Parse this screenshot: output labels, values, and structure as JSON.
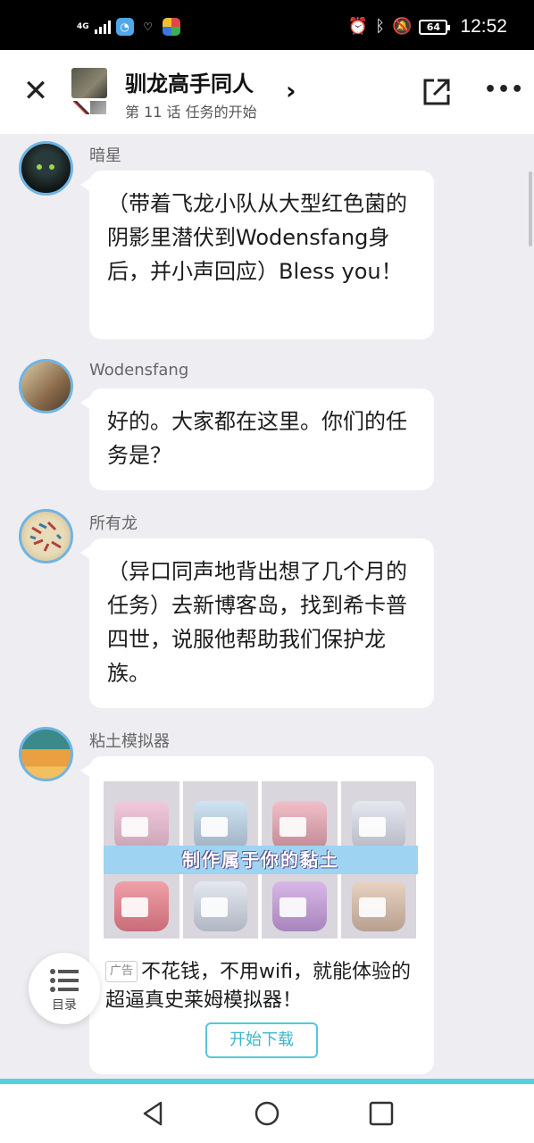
{
  "status_bar": {
    "network": "4G",
    "battery": "64",
    "time": "12:52"
  },
  "header": {
    "title": "驯龙高手同人",
    "subtitle": "第 11 话 任务的开始"
  },
  "messages": [
    {
      "name": "暗星",
      "text": "（带着飞龙小队从大型红色菌的阴影里潜伏到Wodensfang身后，并小声回应）Bless you！"
    },
    {
      "name": "Wodensfang",
      "text": "好的。大家都在这里。你们的任务是？"
    },
    {
      "name": "所有龙",
      "text": "（异口同声地背出想了几个月的任务）去新博客岛，找到希卡普四世，说服他帮助我们保护龙族。"
    },
    {
      "name": "粘土模拟器"
    }
  ],
  "ad": {
    "banner": "制作属于你的黏土",
    "tag": "广告",
    "text": "不花钱，不用wifi，就能体验的超逼真史莱姆模拟器！",
    "button": "开始下载"
  },
  "toc": {
    "label": "目录"
  },
  "colors": {
    "accent": "#55d0e0",
    "avatar_ring": "#6fb4e3"
  }
}
